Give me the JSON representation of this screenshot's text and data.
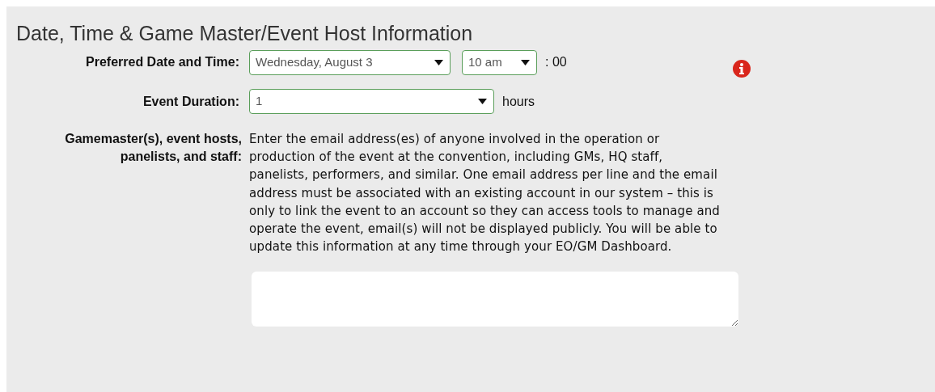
{
  "section": {
    "title": "Date, Time & Game Master/Event Host Information"
  },
  "date_time": {
    "label": "Preferred Date and Time:",
    "date": "Wednesday, August 3",
    "time": "10 am",
    "minutes": ": 00"
  },
  "duration": {
    "label": "Event Duration:",
    "value": "1",
    "unit": "hours"
  },
  "staff": {
    "label_lines": [
      "Gamemaster(s), event hosts,",
      "panelists, and staff:"
    ],
    "description": "Enter the email address(es) of anyone involved in the operation or production of the event at the convention, including GMs, HQ staff, panelists, performers, and similar. One email address per line and the email address must be associated with an existing account in our system – this is only to link the event to an account so they can access tools to manage and operate the event, email(s) will not be displayed publicly. You will be able to update this information at any time through your EO/GM Dashboard."
  }
}
